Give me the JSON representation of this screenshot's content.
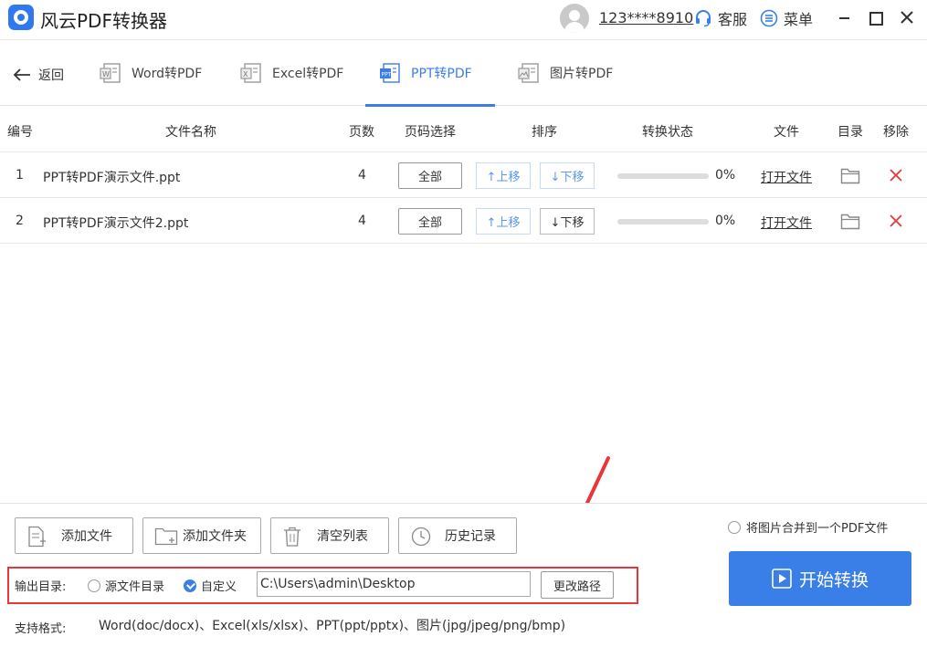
{
  "app": {
    "title": "风云PDF转换器",
    "user_id": "123****8910",
    "service_label": "客服",
    "menu_label": "菜单"
  },
  "nav": {
    "back_label": "返回",
    "tabs": [
      {
        "label": "Word转PDF",
        "active": false
      },
      {
        "label": "Excel转PDF",
        "active": false
      },
      {
        "label": "PPT转PDF",
        "active": true
      },
      {
        "label": "图片转PDF",
        "active": false
      }
    ]
  },
  "table": {
    "headers": {
      "index": "编号",
      "name": "文件名称",
      "pages": "页数",
      "page_select": "页码选择",
      "order": "排序",
      "status": "转换状态",
      "file": "文件",
      "dir": "目录",
      "remove": "移除"
    },
    "rows": [
      {
        "index": "1",
        "name": "PPT转PDF演示文件.ppt",
        "pages": "4",
        "page_select": "全部",
        "move_up": "↑上移",
        "move_down": "↓下移",
        "progress_percent": 0,
        "progress_text": "0%",
        "open_file": "打开文件"
      },
      {
        "index": "2",
        "name": "PPT转PDF演示文件2.ppt",
        "pages": "4",
        "page_select": "全部",
        "move_up": "↑上移",
        "move_down": "↓下移",
        "progress_percent": 0,
        "progress_text": "0%",
        "open_file": "打开文件"
      }
    ]
  },
  "actions": {
    "add_file": "添加文件",
    "add_folder": "添加文件夹",
    "clear_list": "清空列表",
    "history": "历史记录"
  },
  "options": {
    "merge_images": "将图片合并到一个PDF文件",
    "merge_checked": false
  },
  "output": {
    "label": "输出目录:",
    "source_dir": "源文件目录",
    "source_selected": false,
    "custom": "自定义",
    "custom_selected": true,
    "path": "C:\\Users\\admin\\Desktop",
    "change_path": "更改路径"
  },
  "start_label": "开始转换",
  "formats": {
    "label": "支持格式:",
    "text": "Word(doc/docx)、Excel(xls/xlsx)、PPT(ppt/pptx)、图片(jpg/jpeg/png/bmp)"
  },
  "colors": {
    "accent": "#3a7ee8",
    "highlight": "#e8363a",
    "remove": "#e8363a"
  }
}
